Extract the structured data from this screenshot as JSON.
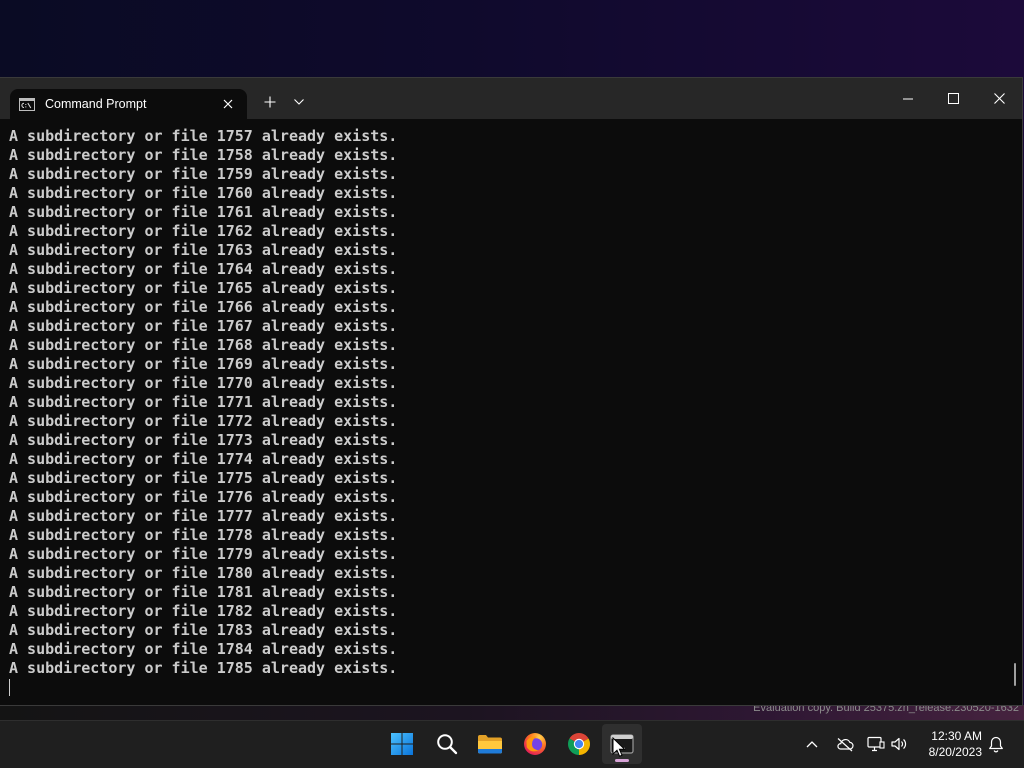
{
  "window": {
    "tab": {
      "title": "Command Prompt",
      "icon": "cmd-icon",
      "close_icon": "close-tab-icon"
    },
    "new_tab_icon": "plus-icon",
    "dropdown_icon": "chevron-down-icon",
    "controls": [
      "minimize-icon",
      "maximize-icon",
      "close-icon"
    ]
  },
  "console": {
    "lines": [
      "A subdirectory or file 1757 already exists.",
      "A subdirectory or file 1758 already exists.",
      "A subdirectory or file 1759 already exists.",
      "A subdirectory or file 1760 already exists.",
      "A subdirectory or file 1761 already exists.",
      "A subdirectory or file 1762 already exists.",
      "A subdirectory or file 1763 already exists.",
      "A subdirectory or file 1764 already exists.",
      "A subdirectory or file 1765 already exists.",
      "A subdirectory or file 1766 already exists.",
      "A subdirectory or file 1767 already exists.",
      "A subdirectory or file 1768 already exists.",
      "A subdirectory or file 1769 already exists.",
      "A subdirectory or file 1770 already exists.",
      "A subdirectory or file 1771 already exists.",
      "A subdirectory or file 1772 already exists.",
      "A subdirectory or file 1773 already exists.",
      "A subdirectory or file 1774 already exists.",
      "A subdirectory or file 1775 already exists.",
      "A subdirectory or file 1776 already exists.",
      "A subdirectory or file 1777 already exists.",
      "A subdirectory or file 1778 already exists.",
      "A subdirectory or file 1779 already exists.",
      "A subdirectory or file 1780 already exists.",
      "A subdirectory or file 1781 already exists.",
      "A subdirectory or file 1782 already exists.",
      "A subdirectory or file 1783 already exists.",
      "A subdirectory or file 1784 already exists.",
      "A subdirectory or file 1785 already exists."
    ]
  },
  "desktop": {
    "watermark": "Evaluation copy. Build 25375.zn_release.230520-1632"
  },
  "taskbar": {
    "pinned_icons": [
      "windows-logo-icon",
      "search-icon",
      "file-explorer-icon",
      "firefox-icon",
      "chrome-icon",
      "terminal-icon"
    ],
    "active_icon": "terminal-icon"
  },
  "tray": {
    "icons": [
      "chevron-up-icon",
      "onedrive-offline-icon",
      "network-icon",
      "volume-icon"
    ],
    "time": "12:30 AM",
    "date": "8/20/2023",
    "notification_icon": "notification-bell-icon"
  },
  "colors": {
    "console_bg": "#0c0c0c",
    "console_fg": "#cccccc",
    "tabbar_bg": "#272727",
    "taskbar_bg": "#1f1f1f",
    "active_indicator": "#d8a4d8"
  }
}
